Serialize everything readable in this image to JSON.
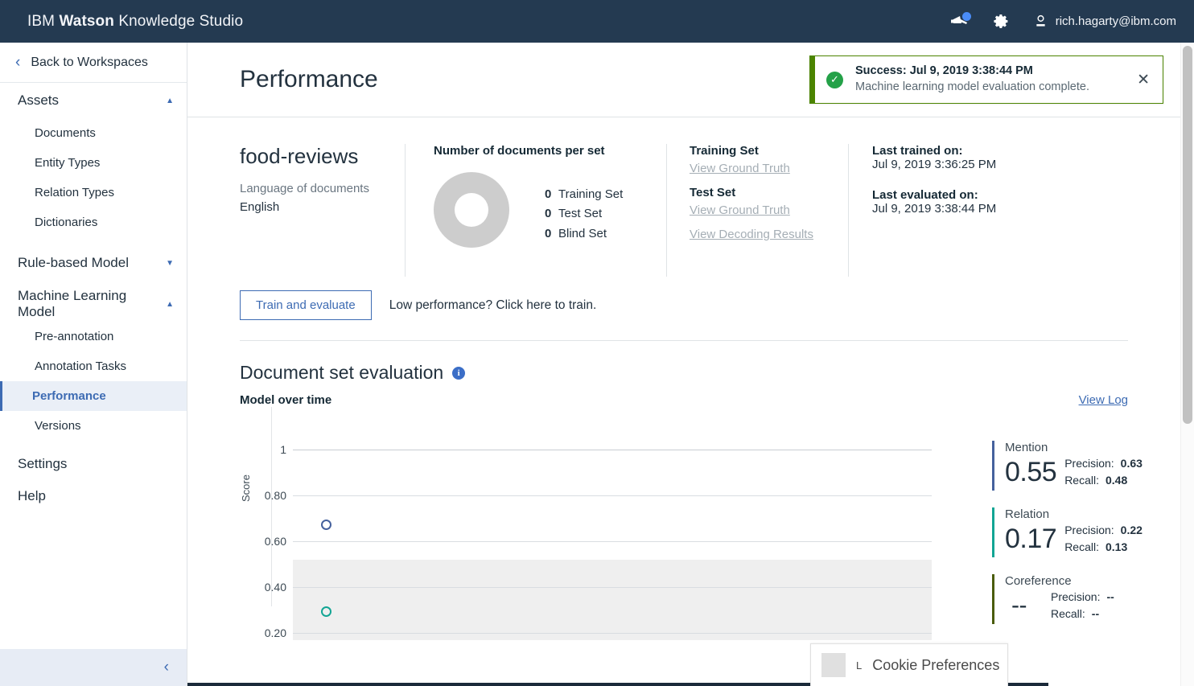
{
  "header": {
    "brand_prefix": "IBM ",
    "brand_bold": "Watson",
    "brand_suffix": " Knowledge Studio",
    "announcement_icon": "megaphone-icon",
    "settings_icon": "gear-icon",
    "user_icon": "user-avatar-icon",
    "user_email": "rich.hagarty@ibm.com"
  },
  "sidebar": {
    "back_label": "Back to Workspaces",
    "back_icon": "chevron-left-icon",
    "sections": [
      {
        "label": "Assets",
        "caret": "▲",
        "items": [
          "Documents",
          "Entity Types",
          "Relation Types",
          "Dictionaries"
        ]
      },
      {
        "label": "Rule-based Model",
        "caret": "▼",
        "items": []
      },
      {
        "label": "Machine Learning Model",
        "caret": "▲",
        "items": [
          "Pre-annotation",
          "Annotation Tasks",
          "Performance",
          "Versions"
        ]
      }
    ],
    "plain_items": [
      "Settings",
      "Help"
    ],
    "active_item": "Performance",
    "collapse_icon": "chevron-left-icon"
  },
  "page": {
    "title": "Performance"
  },
  "toast": {
    "icon": "success-check-icon",
    "title": "Success: Jul 9, 2019 3:38:44 PM",
    "message": "Machine learning model evaluation complete.",
    "close_icon": "close-icon",
    "accent_color": "#4b8400"
  },
  "summary": {
    "workspace_name": "food-reviews",
    "language_label": "Language of documents",
    "language_value": "English",
    "docs_heading": "Number of documents per set",
    "sets": [
      {
        "count": "0",
        "name": "Training Set"
      },
      {
        "count": "0",
        "name": "Test Set"
      },
      {
        "count": "0",
        "name": "Blind Set"
      }
    ],
    "ground_truth": {
      "training_label": "Training Set",
      "training_link": "View Ground Truth",
      "test_label": "Test Set",
      "test_link": "View Ground Truth",
      "decoding_link": "View Decoding Results"
    },
    "meta": {
      "trained_label": "Last trained on:",
      "trained_value": "Jul 9, 2019 3:36:25 PM",
      "evaluated_label": "Last evaluated on:",
      "evaluated_value": "Jul 9, 2019 3:38:44 PM"
    }
  },
  "train": {
    "button_label": "Train and evaluate",
    "hint": "Low performance? Click here to train."
  },
  "evaluation": {
    "section_title": "Document set evaluation",
    "info_icon": "info-icon",
    "info_glyph": "i",
    "chart_subtitle": "Model over time",
    "view_log": "View Log"
  },
  "chart_data": {
    "type": "scatter",
    "title": "Model over time",
    "xlabel": "",
    "ylabel": "Score",
    "ylim": [
      0,
      1
    ],
    "grid": true,
    "y_ticks": [
      "1",
      "0.80",
      "0.60",
      "0.40",
      "0.20"
    ],
    "y_tick_values": [
      1,
      0.8,
      0.6,
      0.4,
      0.2
    ],
    "shaded_band": {
      "from": 0.0,
      "to": 0.48,
      "color": "#efefef"
    },
    "series": [
      {
        "name": "Mention",
        "color": "#45619d",
        "x": [
          0
        ],
        "values": [
          0.55
        ]
      },
      {
        "name": "Relation",
        "color": "#12a594",
        "x": [
          0
        ],
        "values": [
          0.17
        ]
      }
    ],
    "legend": "right-panel"
  },
  "metrics": {
    "precision_label": "Precision:",
    "recall_label": "Recall:",
    "cards": [
      {
        "name": "Mention",
        "score": "0.55",
        "precision": "0.63",
        "recall": "0.48",
        "color": "#45619d"
      },
      {
        "name": "Relation",
        "score": "0.17",
        "precision": "0.22",
        "recall": "0.13",
        "color": "#12a594"
      },
      {
        "name": "Coreference",
        "score": "--",
        "precision": "--",
        "recall": "--",
        "color": "#4a5c0a"
      }
    ]
  },
  "cookie": {
    "l_mark": "L",
    "label": "Cookie Preferences"
  }
}
